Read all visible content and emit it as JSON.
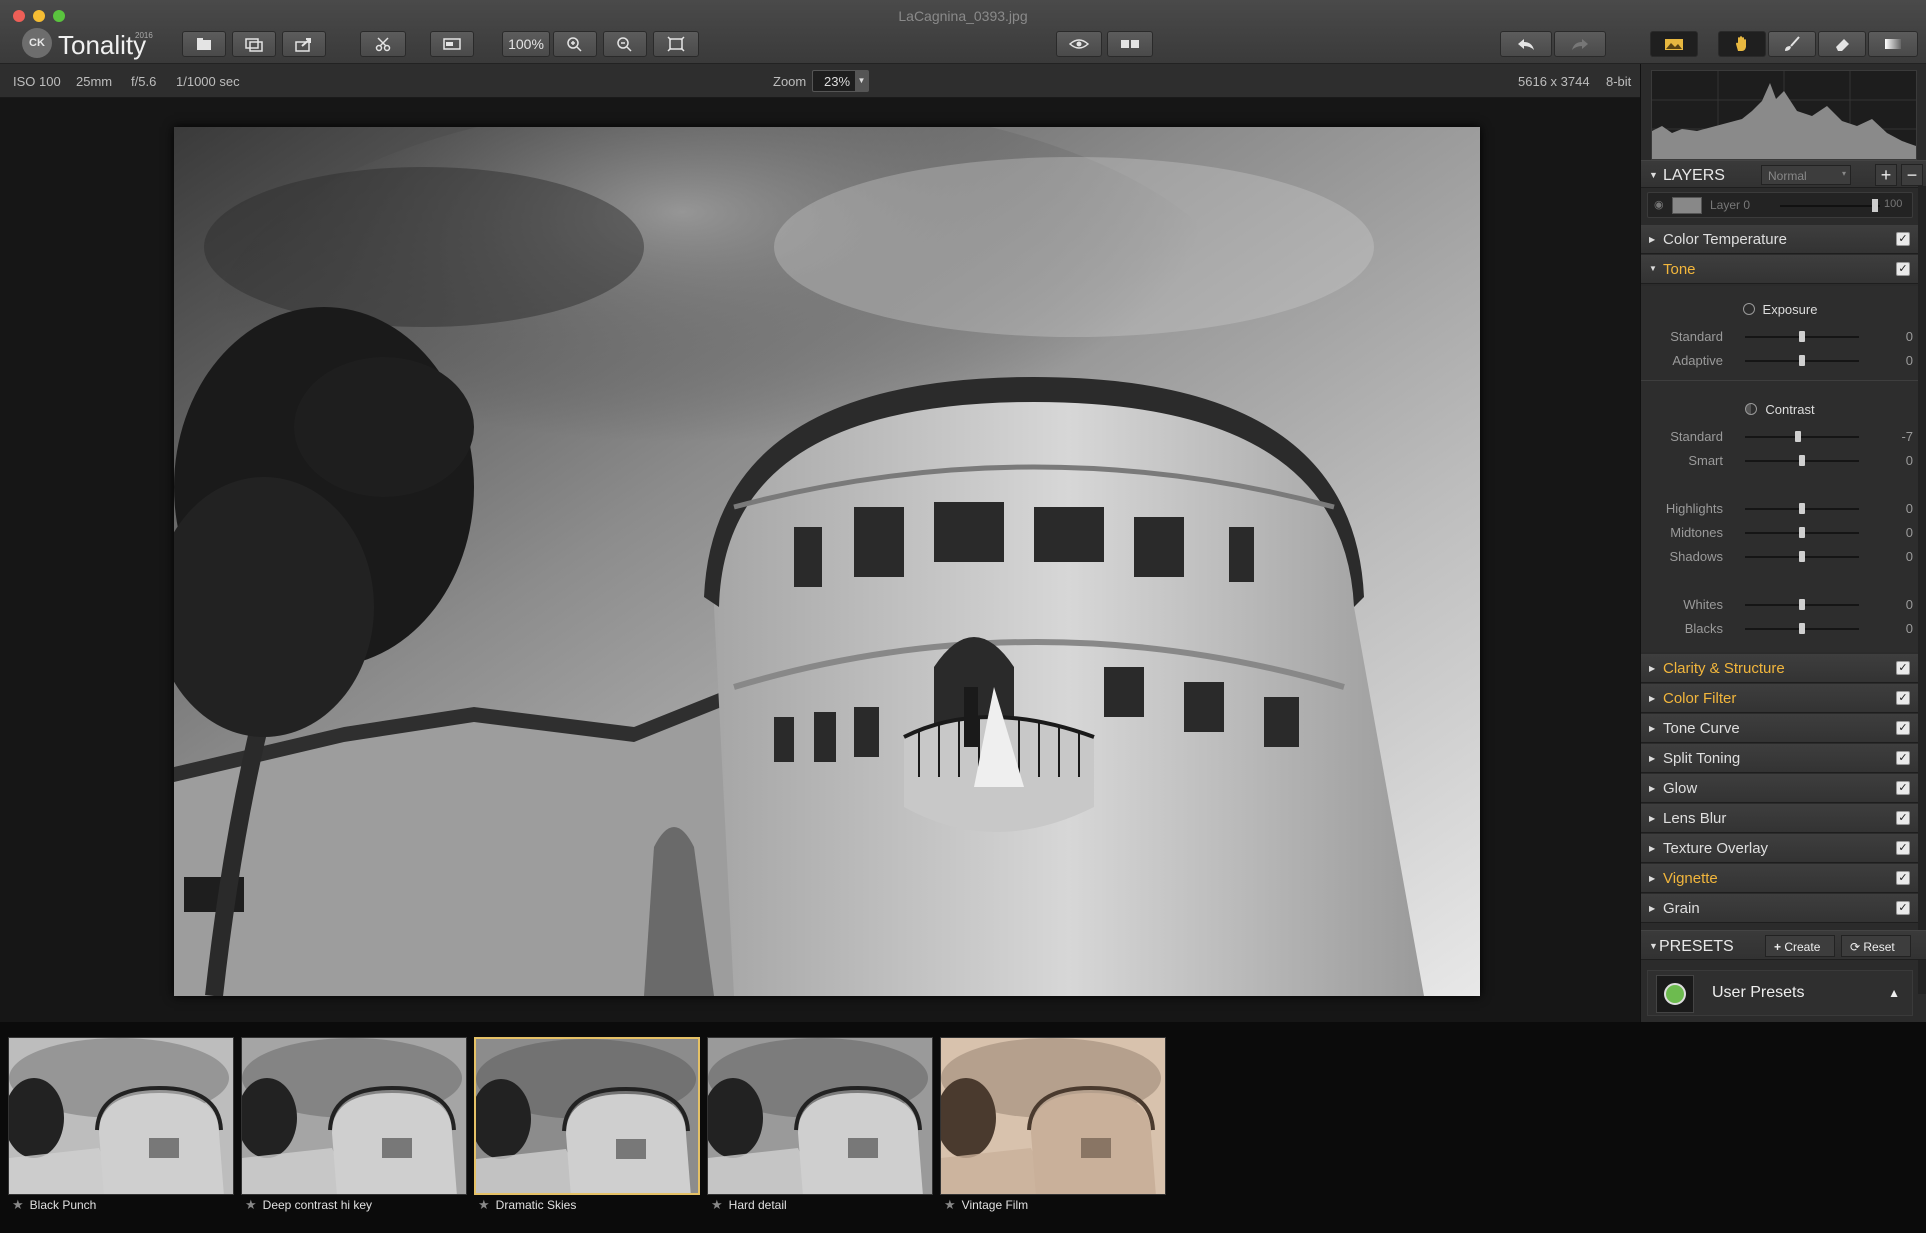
{
  "window": {
    "title": "LaCagnina_0393.jpg"
  },
  "app": {
    "logo_text": "CK",
    "name": "Tonality",
    "year": "2016"
  },
  "toolbar": {
    "zoom_100_label": "100%",
    "icons": [
      "open-icon",
      "batch-icon",
      "share-icon",
      "crop-icon",
      "compare-icon",
      "zoom-in-icon",
      "zoom-out-icon",
      "fit-icon",
      "preview-eye-icon",
      "split-view-icon",
      "undo-icon",
      "redo-icon",
      "image-icon",
      "hand-icon",
      "brush-icon",
      "eraser-icon",
      "gradient-icon"
    ]
  },
  "infobar": {
    "iso": "ISO 100",
    "focal": "25mm",
    "aperture": "f/5.6",
    "shutter": "1/1000 sec",
    "zoom_label": "Zoom",
    "zoom_value": "23%",
    "dimensions": "5616 x 3744",
    "bitdepth": "8-bit"
  },
  "layers": {
    "title": "LAYERS",
    "blend_mode": "Normal",
    "layer_name": "Layer 0",
    "opacity": "100"
  },
  "sections": [
    {
      "label": "Color Temperature",
      "active": false,
      "checked": true
    },
    {
      "label": "Tone",
      "active": true,
      "checked": true
    }
  ],
  "tone": {
    "exposure_title": "Exposure",
    "contrast_title": "Contrast",
    "sliders": [
      {
        "label": "Standard",
        "value": "0"
      },
      {
        "label": "Adaptive",
        "value": "0"
      },
      {
        "label": "Standard",
        "value": "-7"
      },
      {
        "label": "Smart",
        "value": "0"
      },
      {
        "label": "Highlights",
        "value": "0"
      },
      {
        "label": "Midtones",
        "value": "0"
      },
      {
        "label": "Shadows",
        "value": "0"
      },
      {
        "label": "Whites",
        "value": "0"
      },
      {
        "label": "Blacks",
        "value": "0"
      }
    ]
  },
  "more_sections": [
    {
      "label": "Clarity & Structure",
      "active": true
    },
    {
      "label": "Color Filter",
      "active": true
    },
    {
      "label": "Tone Curve",
      "active": false
    },
    {
      "label": "Split Toning",
      "active": false
    },
    {
      "label": "Glow",
      "active": false
    },
    {
      "label": "Lens Blur",
      "active": false
    },
    {
      "label": "Texture Overlay",
      "active": false
    },
    {
      "label": "Vignette",
      "active": true
    },
    {
      "label": "Grain",
      "active": false
    }
  ],
  "presets": {
    "title": "PRESETS",
    "create_label": "Create",
    "reset_label": "Reset",
    "category": "User Presets"
  },
  "filmstrip": [
    {
      "name": "Black Punch",
      "selected": false
    },
    {
      "name": "Deep contrast hi key",
      "selected": false
    },
    {
      "name": "Dramatic Skies",
      "selected": true
    },
    {
      "name": "Hard detail",
      "selected": false
    },
    {
      "name": "Vintage Film",
      "selected": false
    }
  ],
  "colors": {
    "accent": "#f2b63c",
    "selection": "#e5c166"
  }
}
